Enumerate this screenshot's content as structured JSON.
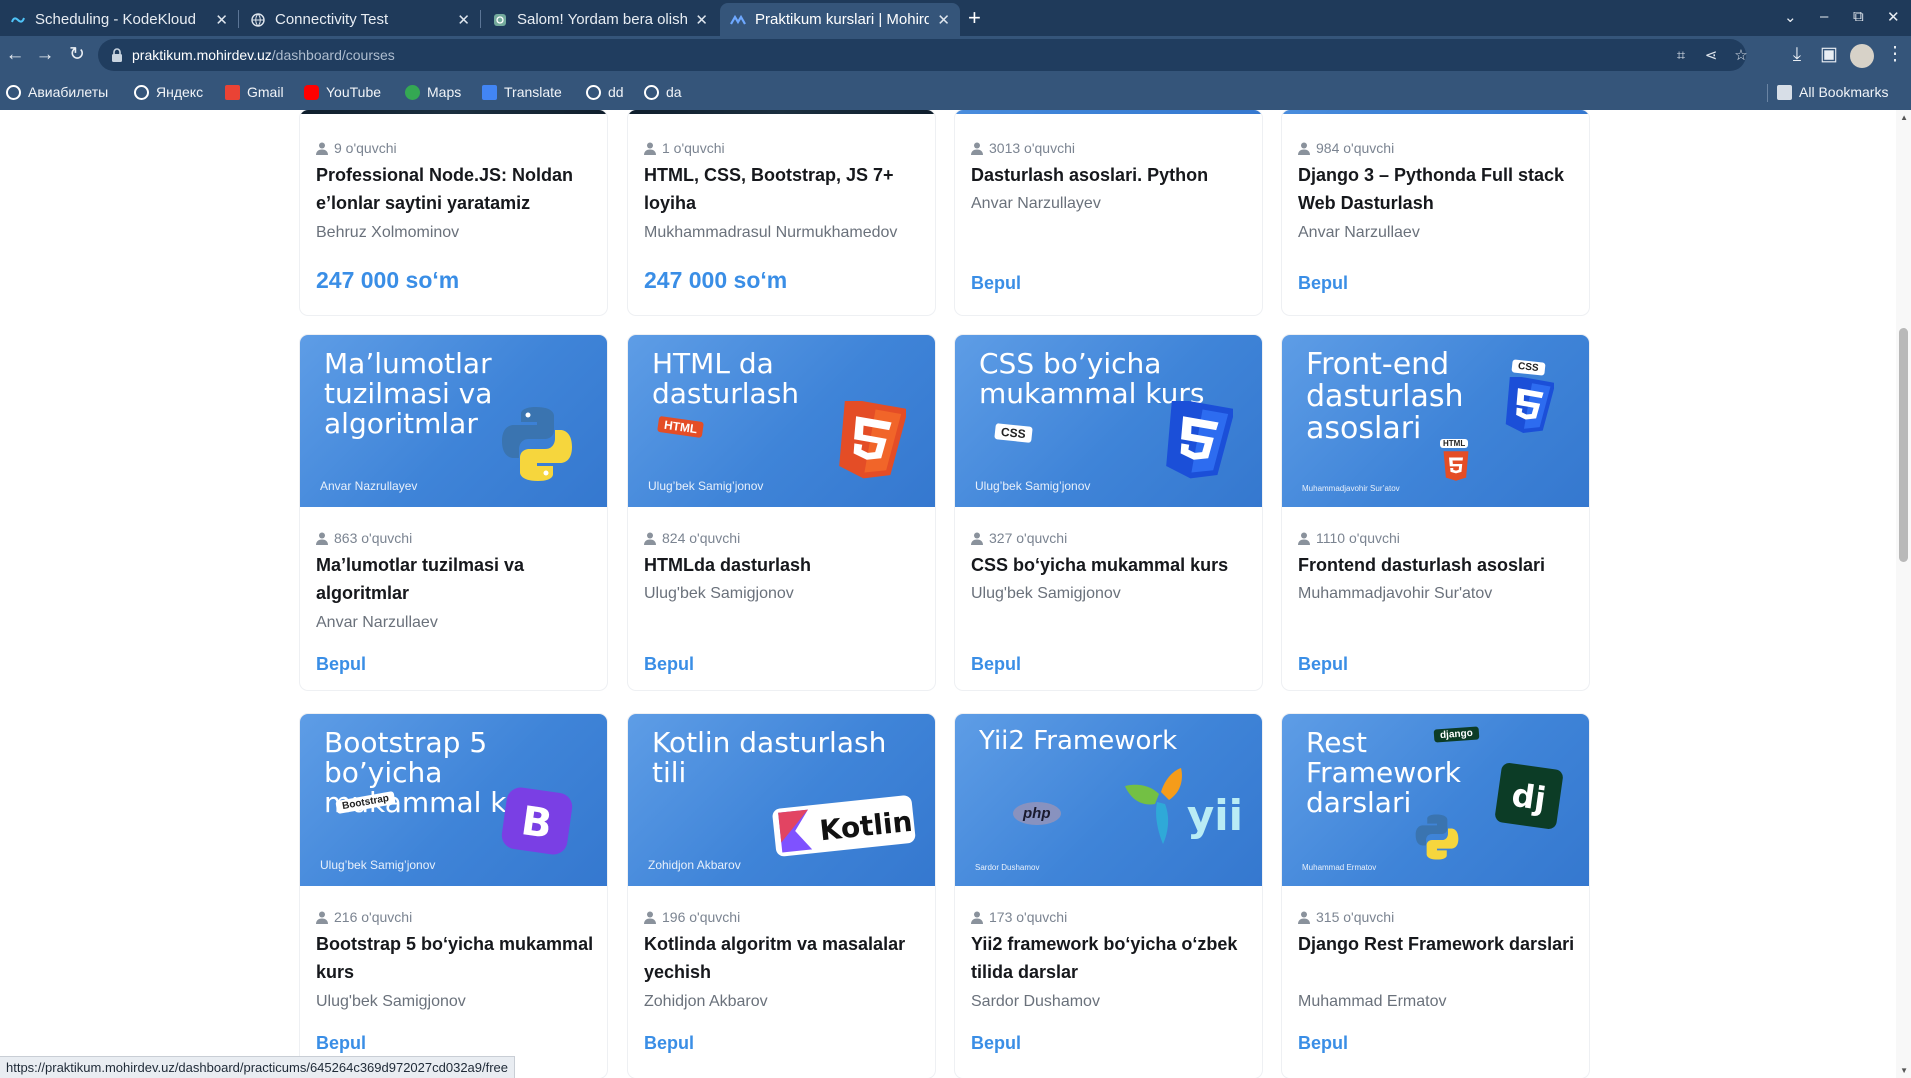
{
  "browser": {
    "tabs": [
      {
        "title": "Scheduling - KodeKloud",
        "active": false
      },
      {
        "title": "Connectivity Test",
        "active": false
      },
      {
        "title": "Salom! Yordam bera olishim",
        "active": false
      },
      {
        "title": "Praktikum kurslari | Mohirdev",
        "active": true
      }
    ],
    "new_tab": "+",
    "url_host": "praktikum.mohirdev.uz",
    "url_path": "/dashboard/courses",
    "bookmarks": [
      {
        "label": "Авиабилеты",
        "color": "#ffffff"
      },
      {
        "label": "Яндекс",
        "color": "#ffffff"
      },
      {
        "label": "Gmail",
        "color": "#ea4335"
      },
      {
        "label": "YouTube",
        "color": "#ff0000"
      },
      {
        "label": "Maps",
        "color": "#34a853"
      },
      {
        "label": "Translate",
        "color": "#4285f4"
      },
      {
        "label": "dd",
        "color": "#ffffff"
      },
      {
        "label": "da",
        "color": "#ffffff"
      }
    ],
    "all_bookmarks": "All Bookmarks",
    "status_url": "https://praktikum.mohirdev.uz/dashboard/practicums/645264c369d972027cd032a9/free"
  },
  "courses_top": [
    {
      "students": "9 o'quvchi",
      "title": "Professional Node.JS: Noldan e’lonlar saytini yaratamiz",
      "author": "Behruz Xolmominov",
      "price": "247 000 so‘m"
    },
    {
      "students": "1 o'quvchi",
      "title": "HTML, CSS, Bootstrap, JS 7+ loyiha",
      "author": "Mukhammadrasul Nurmukhamedov",
      "price": "247 000 so‘m"
    },
    {
      "students": "3013 o'quvchi",
      "title": "Dasturlash asoslari. Python",
      "author": "Anvar Narzullayev",
      "price": "Bepul"
    },
    {
      "students": "984 o'quvchi",
      "title": "Django 3 – Pythonda Full stack Web Dasturlash",
      "author": "Anvar Narzullaev",
      "price": "Bepul"
    }
  ],
  "courses_row2": [
    {
      "banner_title": "Ma’lumotlar tuzilmasi va algoritmlar",
      "banner_author": "Anvar Nazrullayev",
      "students": "863 o'quvchi",
      "title": "Ma’lumotlar tuzilmasi va algoritmlar",
      "author": "Anvar Narzullaev",
      "price": "Bepul"
    },
    {
      "banner_title": "HTML da dasturlash",
      "banner_author": "Ulug’bek Samig’jonov",
      "sticker": "HTML",
      "students": "824 o'quvchi",
      "title": "HTMLda dasturlash",
      "author": "Ulug'bek Samigjonov",
      "price": "Bepul"
    },
    {
      "banner_title": "CSS bo’yicha mukammal kurs",
      "banner_author": "Ulug’bek Samig’jonov",
      "sticker": "CSS",
      "students": "327 o'quvchi",
      "title": "CSS bo‘yicha mukammal kurs",
      "author": "Ulug'bek Samigjonov",
      "price": "Bepul"
    },
    {
      "banner_title": "Front-end dasturlash asoslari",
      "banner_author": "Muhammadjavohir Sur’atov",
      "sticker": "CSS",
      "sticker2": "HTML",
      "students": "1110 o'quvchi",
      "title": "Frontend dasturlash asoslari",
      "author": "Muhammadjavohir Sur'atov",
      "price": "Bepul"
    }
  ],
  "courses_row3": [
    {
      "banner_title": "Bootstrap 5 bo’yicha mukammal kurs",
      "banner_author": "Ulug’bek Samig’jonov",
      "sticker": "Bootstrap",
      "students": "216 o'quvchi",
      "title": "Bootstrap 5 bo‘yicha mukammal kurs",
      "author": "Ulug'bek Samigjonov",
      "price": "Bepul"
    },
    {
      "banner_title": "Kotlin dasturlash tili",
      "banner_author": "Zohidjon Akbarov",
      "logo_text": "Kotlin",
      "students": "196 o'quvchi",
      "title": "Kotlinda algoritm va masalalar yechish",
      "author": "Zohidjon Akbarov",
      "price": "Bepul"
    },
    {
      "banner_title": "Yii2 Framework",
      "banner_author": "Sardor Dushamov",
      "sticker": "php",
      "logo_text": "yii",
      "students": "173 o'quvchi",
      "title": "Yii2 framework bo‘yicha o‘zbek tilida darslar",
      "author": "Sardor Dushamov",
      "price": "Bepul"
    },
    {
      "banner_title": "Rest Framework darslari",
      "banner_author": "Muhammad Ermatov",
      "sticker": "django",
      "logo_text": "dj",
      "students": "315 o'quvchi",
      "title": "Django Rest Framework darslari",
      "author": "Muhammad Ermatov",
      "price": "Bepul"
    }
  ]
}
